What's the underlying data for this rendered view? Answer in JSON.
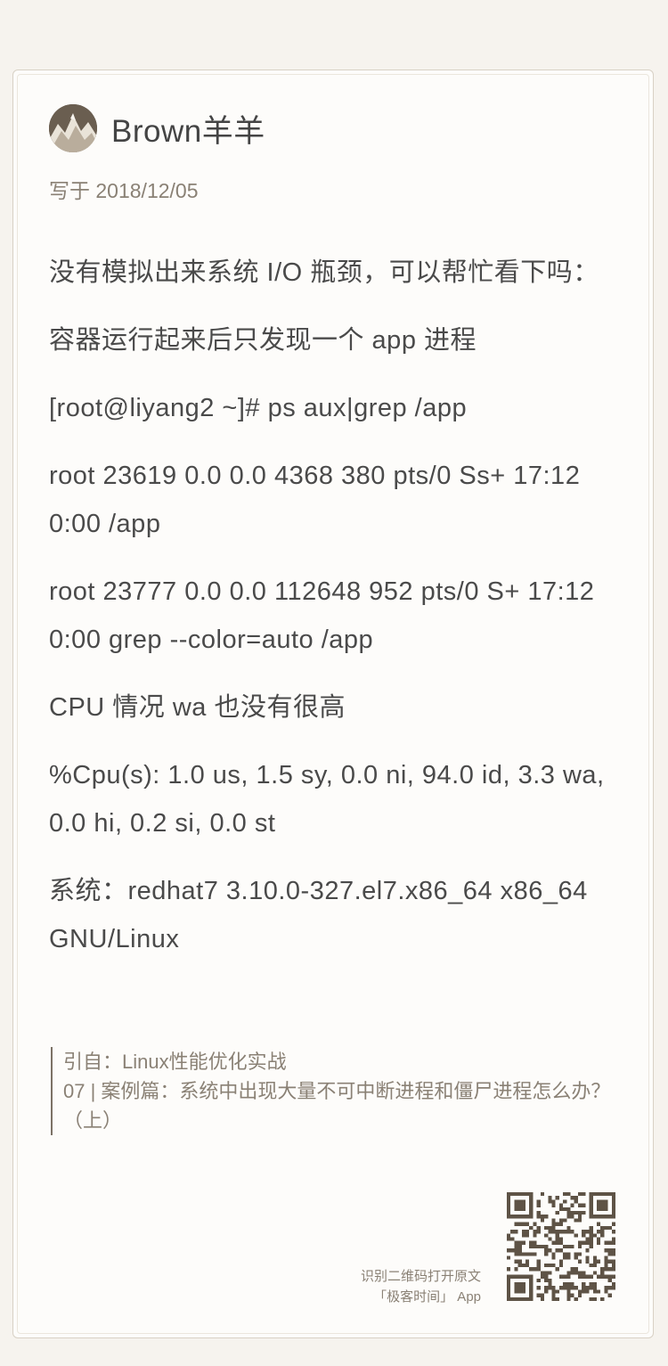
{
  "author": {
    "name": "Brown羊羊",
    "avatar_icon": "landscape-avatar-icon"
  },
  "date": "写于 2018/12/05",
  "paragraphs": [
    "没有模拟出来系统 I/O 瓶颈，可以帮忙看下吗：",
    "容器运行起来后只发现一个 app 进程",
    "[root@liyang2 ~]# ps aux|grep /app",
    "root 23619 0.0 0.0 4368 380 pts/0 Ss+ 17:12 0:00 /app",
    "root 23777 0.0 0.0 112648 952 pts/0 S+ 17:12 0:00 grep --color=auto /app",
    "CPU 情况 wa 也没有很高",
    "%Cpu(s): 1.0 us, 1.5 sy, 0.0 ni, 94.0 id, 3.3 wa, 0.0 hi, 0.2 si, 0.0 st",
    "系统：redhat7 3.10.0-327.el7.x86_64 x86_64 GNU/Linux"
  ],
  "quote": {
    "source": "引自：Linux性能优化实战",
    "article": "07 | 案例篇：系统中出现大量不可中断进程和僵尸进程怎么办？（上）"
  },
  "footer": {
    "line1": "识别二维码打开原文",
    "line2": "「极客时间」 App",
    "qr_icon": "qr-code-icon"
  },
  "colors": {
    "background": "#f6f3ee",
    "card": "#fdfcfa",
    "text": "#4a4a4a",
    "muted": "#8a8175",
    "qr": "#5e5346"
  }
}
